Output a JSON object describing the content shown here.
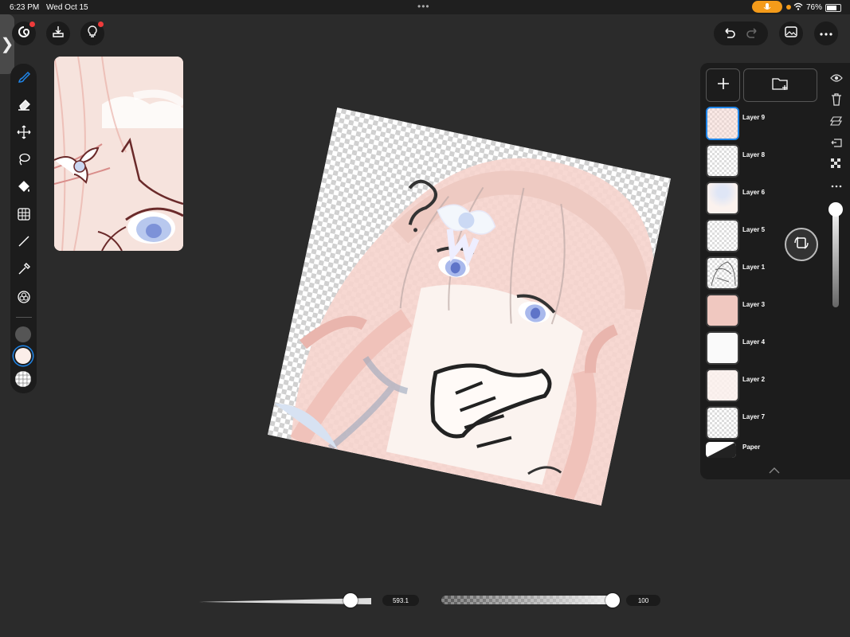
{
  "status_bar": {
    "time": "6:23 PM",
    "date": "Wed Oct 15",
    "multitask": "•••",
    "battery": "76%"
  },
  "top_left": {
    "sidebar_toggle": "❯"
  },
  "layers": [
    {
      "name": "Layer 9",
      "selected": true
    },
    {
      "name": "Layer 8",
      "selected": false
    },
    {
      "name": "Layer 6",
      "selected": false
    },
    {
      "name": "Layer 5",
      "selected": false
    },
    {
      "name": "Layer 1",
      "selected": false
    },
    {
      "name": "Layer 3",
      "selected": false
    },
    {
      "name": "Layer 4",
      "selected": false
    },
    {
      "name": "Layer 2",
      "selected": false
    },
    {
      "name": "Layer 7",
      "selected": false
    },
    {
      "name": "Paper",
      "selected": false
    }
  ],
  "sliders": {
    "size_value": "593.1",
    "opacity_value": "100",
    "size_fraction": 0.88,
    "opacity_fraction": 0.96
  },
  "colors": {
    "accent": "#1f86ea",
    "notification": "#ef3b3b",
    "mic": "#f49b1a",
    "primary_swatch": "#555555",
    "secondary_swatch": "#fbeee9"
  },
  "icons": [
    "brush-icon",
    "eraser-icon",
    "move-icon",
    "lasso-icon",
    "fill-icon",
    "grid-icon",
    "line-icon",
    "eyedropper-icon",
    "color-wheel-icon",
    "undo-icon",
    "redo-icon",
    "gallery-icon",
    "more-icon",
    "eye-icon",
    "trash-icon",
    "merge-icon",
    "export-icon",
    "checker-icon",
    "add-layer-icon",
    "add-folder-icon"
  ]
}
